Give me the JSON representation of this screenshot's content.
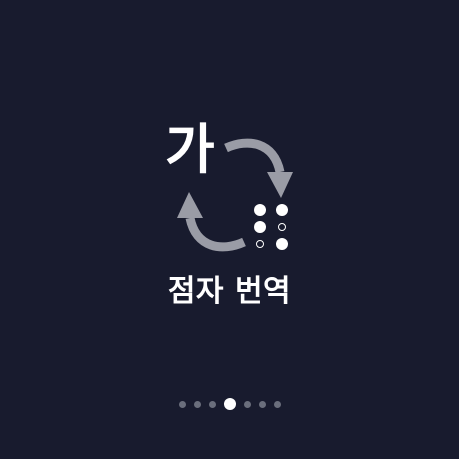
{
  "illustration": {
    "hangul_char": "가",
    "arrow_top_icon": "curved-arrow-down-icon",
    "arrow_bottom_icon": "curved-arrow-up-icon",
    "braille_icon": "braille-cell-icon",
    "braille_dots": [
      {
        "position": 1,
        "raised": true
      },
      {
        "position": 4,
        "raised": true
      },
      {
        "position": 2,
        "raised": true
      },
      {
        "position": 5,
        "raised": false
      },
      {
        "position": 3,
        "raised": false
      },
      {
        "position": 6,
        "raised": true
      }
    ]
  },
  "title": "점자 번역",
  "pager": {
    "total_pages": 7,
    "current_page": 4
  },
  "colors": {
    "background": "#181b2e",
    "text": "#ffffff",
    "arrow": "#9a9ca6",
    "pager_inactive": "#6a6e7c",
    "pager_active": "#ffffff"
  }
}
